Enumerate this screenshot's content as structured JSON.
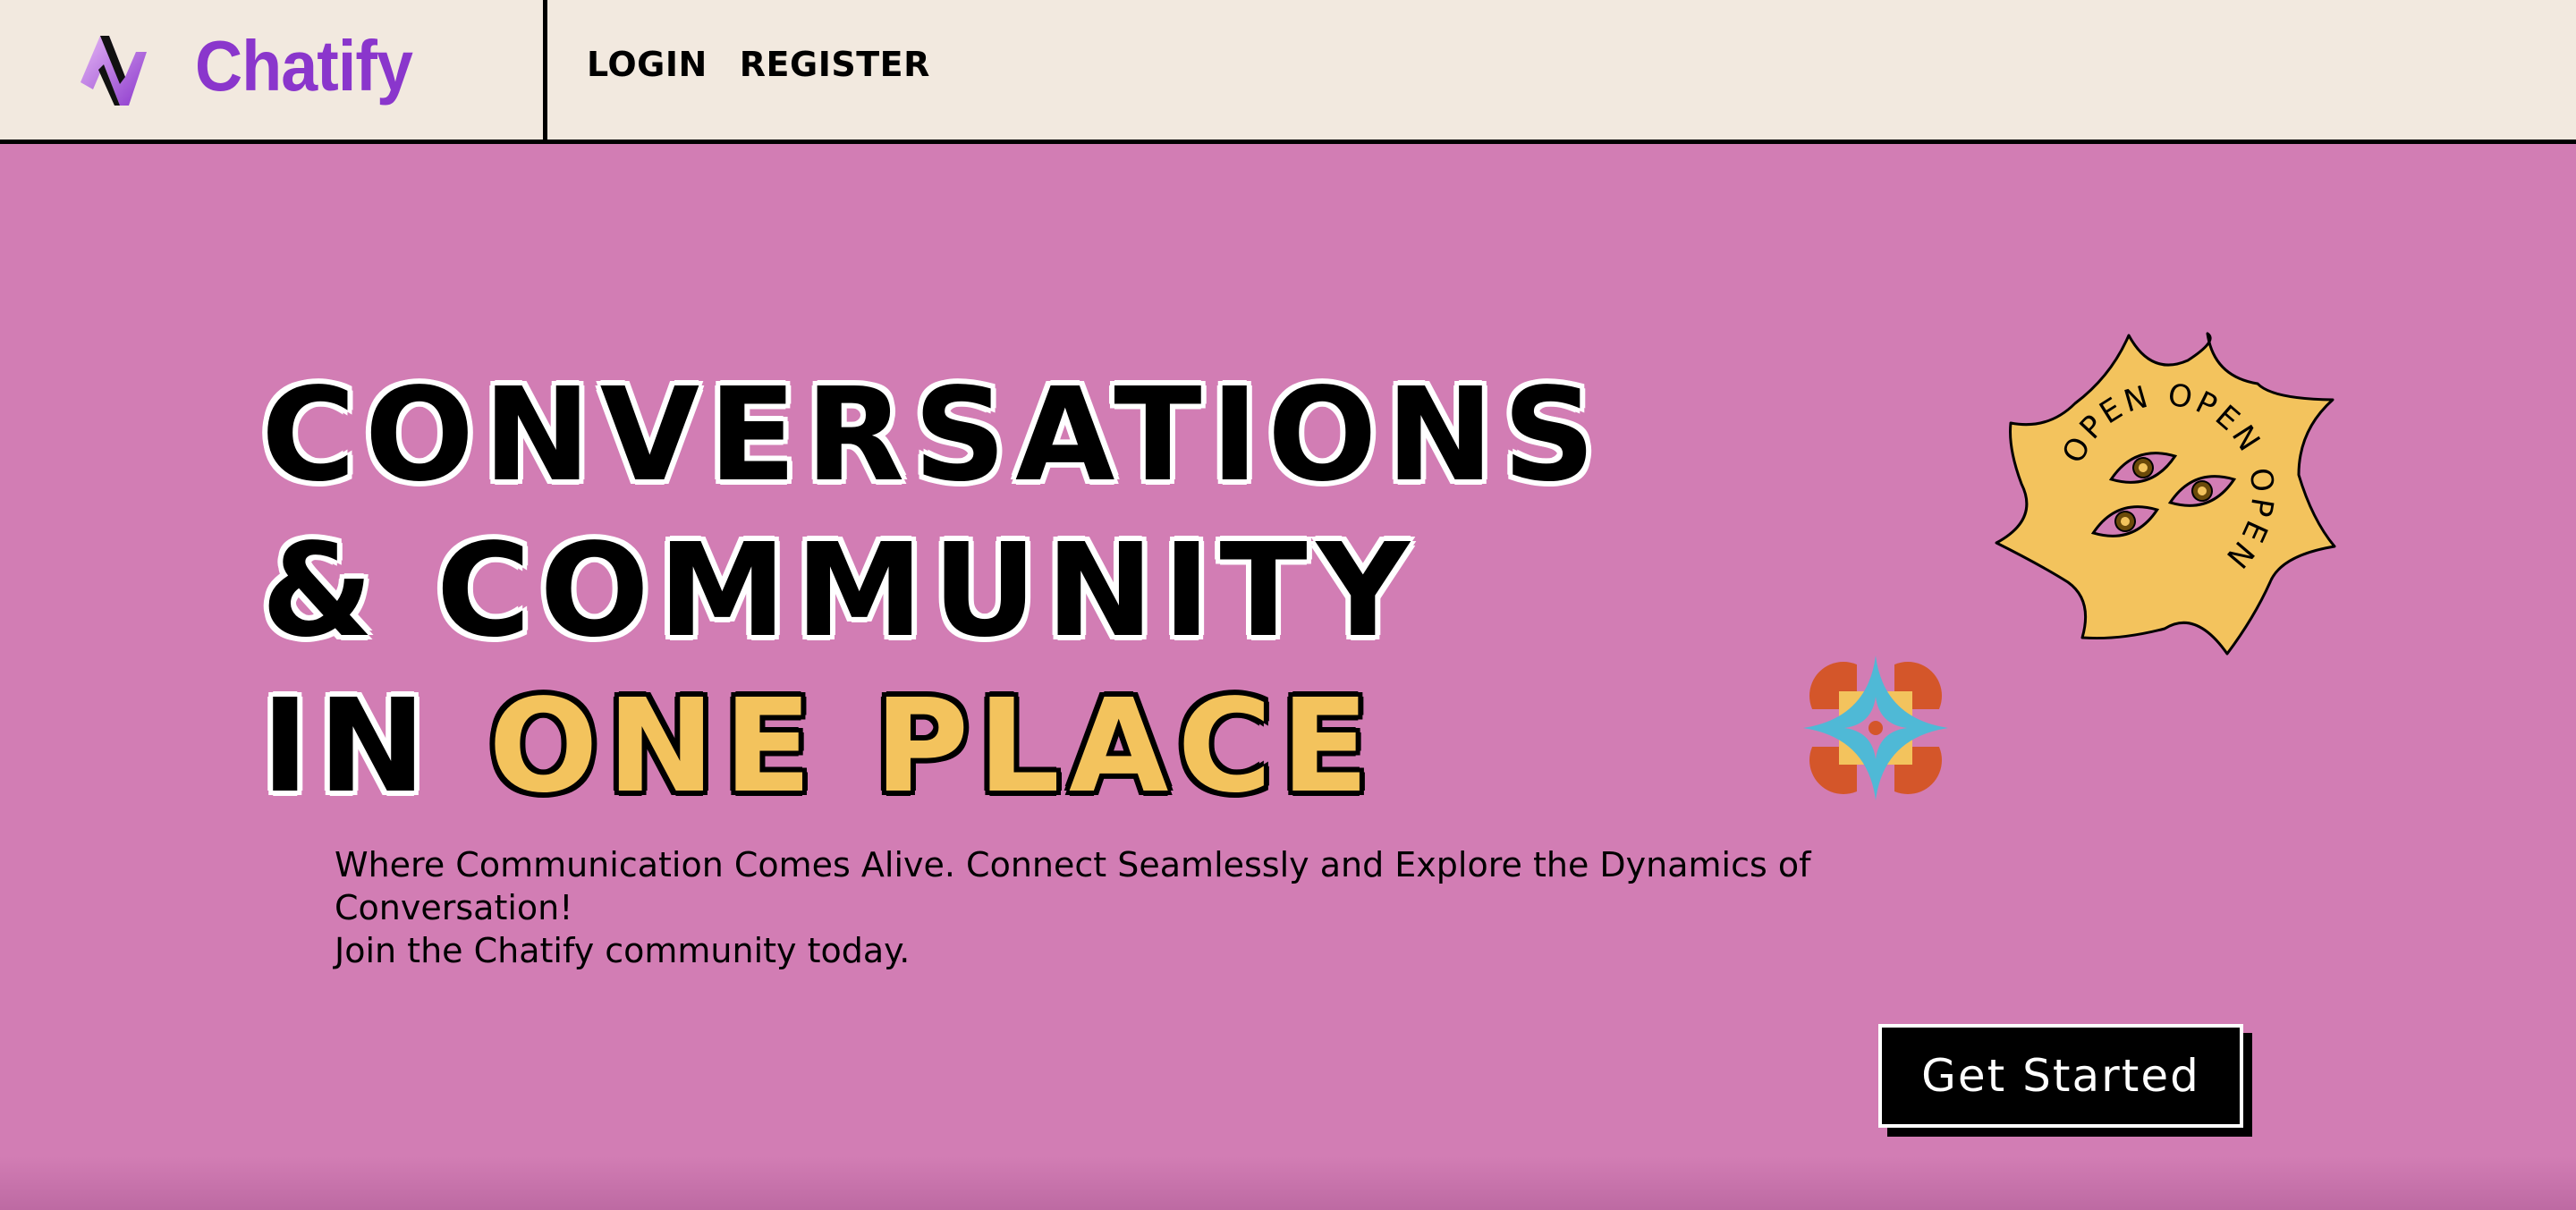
{
  "header": {
    "brand_name": "Chatify",
    "nav": {
      "login": "LOGIN",
      "register": "REGISTER"
    }
  },
  "hero": {
    "headline": {
      "line1": "CONVERSATIONS",
      "line2": "& COMMUNITY",
      "line3_prefix": "IN ",
      "line3_accent": "ONE PLACE"
    },
    "tagline_line1": "Where Communication Comes Alive. Connect Seamlessly and Explore the Dynamics of Conversation!",
    "tagline_line2": "Join the Chatify community today.",
    "cta_label": "Get Started",
    "badge_text": "OPEN OPEN OPEN"
  },
  "colors": {
    "header_bg": "#f2e9df",
    "hero_bg": "#d27db4",
    "brand": "#8a36cc",
    "accent_yellow": "#f3c35d",
    "sparkle_blue": "#4fb9d6",
    "sparkle_orange": "#d4562a"
  },
  "icons": {
    "logo": "chatify-logo-icon",
    "badge": "open-eyes-sun-badge",
    "sparkle": "four-point-star-icon"
  }
}
